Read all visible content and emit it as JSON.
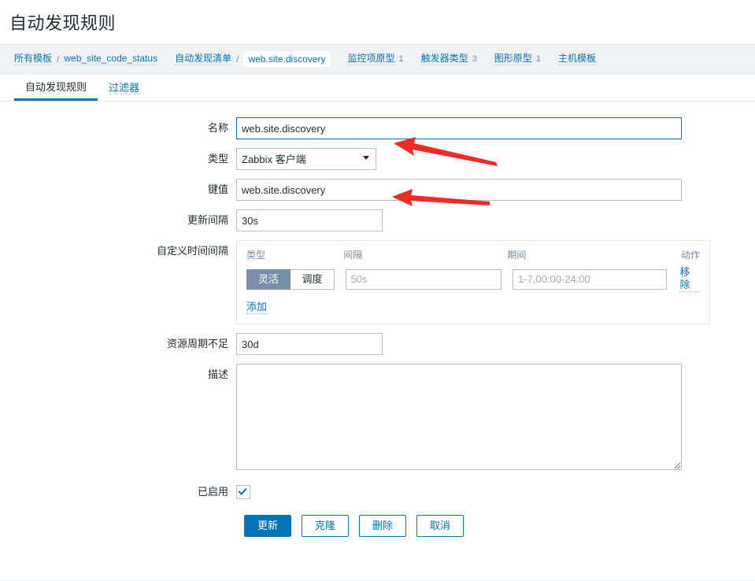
{
  "header": {
    "title": "自动发现规则"
  },
  "breadcrumb": {
    "groups": [
      {
        "items": [
          {
            "label": "所有模板",
            "type": "link"
          },
          {
            "label": "/",
            "type": "sep"
          },
          {
            "label": "web_site_code_status",
            "type": "link"
          }
        ]
      },
      {
        "items": [
          {
            "label": "自动发现清单",
            "type": "link"
          },
          {
            "label": "/",
            "type": "sep"
          },
          {
            "label": "web.site.discovery",
            "type": "current"
          }
        ]
      },
      {
        "items": [
          {
            "label": "监控项原型",
            "type": "link",
            "count": "1"
          }
        ]
      },
      {
        "items": [
          {
            "label": "触发器类型",
            "type": "link",
            "count": "3"
          }
        ]
      },
      {
        "items": [
          {
            "label": "图形原型",
            "type": "link",
            "count": "1"
          }
        ]
      },
      {
        "items": [
          {
            "label": "主机模板",
            "type": "link"
          }
        ]
      }
    ],
    "all_templates": "所有模板",
    "template_name": "web_site_code_status",
    "discovery_list": "自动发现清单",
    "current_rule": "web.site.discovery",
    "item_prototypes": "监控项原型",
    "item_prototypes_count": "1",
    "trigger_prototypes": "触发器类型",
    "trigger_prototypes_count": "3",
    "graph_prototypes": "图形原型",
    "graph_prototypes_count": "1",
    "host_prototypes": "主机模板",
    "separator": "/"
  },
  "tabs": {
    "rule": "自动发现规则",
    "filter": "过滤器"
  },
  "form": {
    "name_label": "名称",
    "name_value": "web.site.discovery",
    "type_label": "类型",
    "type_value": "Zabbix 客户端",
    "type_options": [
      "Zabbix 客户端"
    ],
    "key_label": "键值",
    "key_value": "web.site.discovery",
    "update_interval_label": "更新间隔",
    "update_interval_value": "30s",
    "custom_intervals_label": "自定义时间间隔",
    "lifetime_label": "资源周期不足",
    "lifetime_value": "30d",
    "description_label": "描述",
    "description_value": "",
    "enabled_label": "已启用",
    "enabled_checked": true
  },
  "custom_intervals": {
    "col_type": "类型",
    "col_interval": "间隔",
    "col_period": "期间",
    "col_action": "动作",
    "toggle_flexible": "灵活",
    "toggle_scheduling": "调度",
    "active_toggle": "灵活",
    "interval_placeholder": "50s",
    "interval_value": "",
    "period_placeholder": "1-7,00:00-24:00",
    "period_value": "",
    "remove_label": "移除",
    "add_label": "添加"
  },
  "buttons": {
    "update": "更新",
    "clone": "克隆",
    "delete": "删除",
    "cancel": "取消"
  },
  "colors": {
    "accent": "#0275b8",
    "toggle_active": "#768ea8",
    "annotation": "#ee2b24",
    "breadcrumb_bg": "#f0f3f6"
  },
  "annotations": [
    {
      "name": "arrow-to-name-field",
      "color": "#ee2b24"
    },
    {
      "name": "arrow-to-key-field",
      "color": "#ee2b24"
    }
  ]
}
